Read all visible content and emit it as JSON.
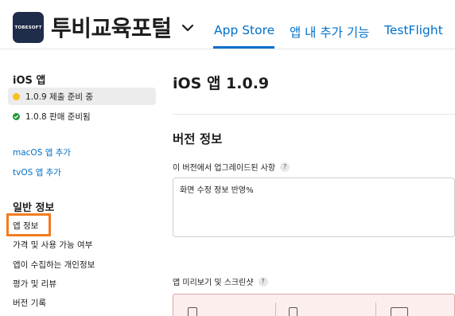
{
  "header": {
    "logo_text": "TOBESOFT",
    "app_name": "투비교육포털",
    "nav": [
      "App Store",
      "앱 내 추가 기능",
      "TestFlight"
    ],
    "active_nav": "App Store",
    "accent_color": "#0070c9"
  },
  "sidebar": {
    "ios_section": "iOS 앱",
    "versions": [
      {
        "label": "1.0.9 제출 준비 중",
        "status": "yellow",
        "selected": true
      },
      {
        "label": "1.0.8 판매 준비됨",
        "status": "green",
        "selected": false
      }
    ],
    "platform_links": [
      "macOS 앱 추가",
      "tvOS 앱 추가"
    ],
    "general_section": "일반 정보",
    "general_items": [
      "앱 정보",
      "가격 및 사용 가능 여부",
      "앱이 수집하는 개인정보",
      "평가 및 리뷰",
      "버전 기록"
    ],
    "highlighted_item": "앱 정보",
    "highlight_color": "#f47b20"
  },
  "main": {
    "title": "iOS 앱 1.0.9",
    "version_info_title": "버전 정보",
    "whats_new_label": "이 버전에서 업그레이드된 사항",
    "whats_new_value": "화면 수정 정보 반영%",
    "previews_label": "앱 미리보기 및 스크린샷",
    "help_symbol": "?"
  }
}
